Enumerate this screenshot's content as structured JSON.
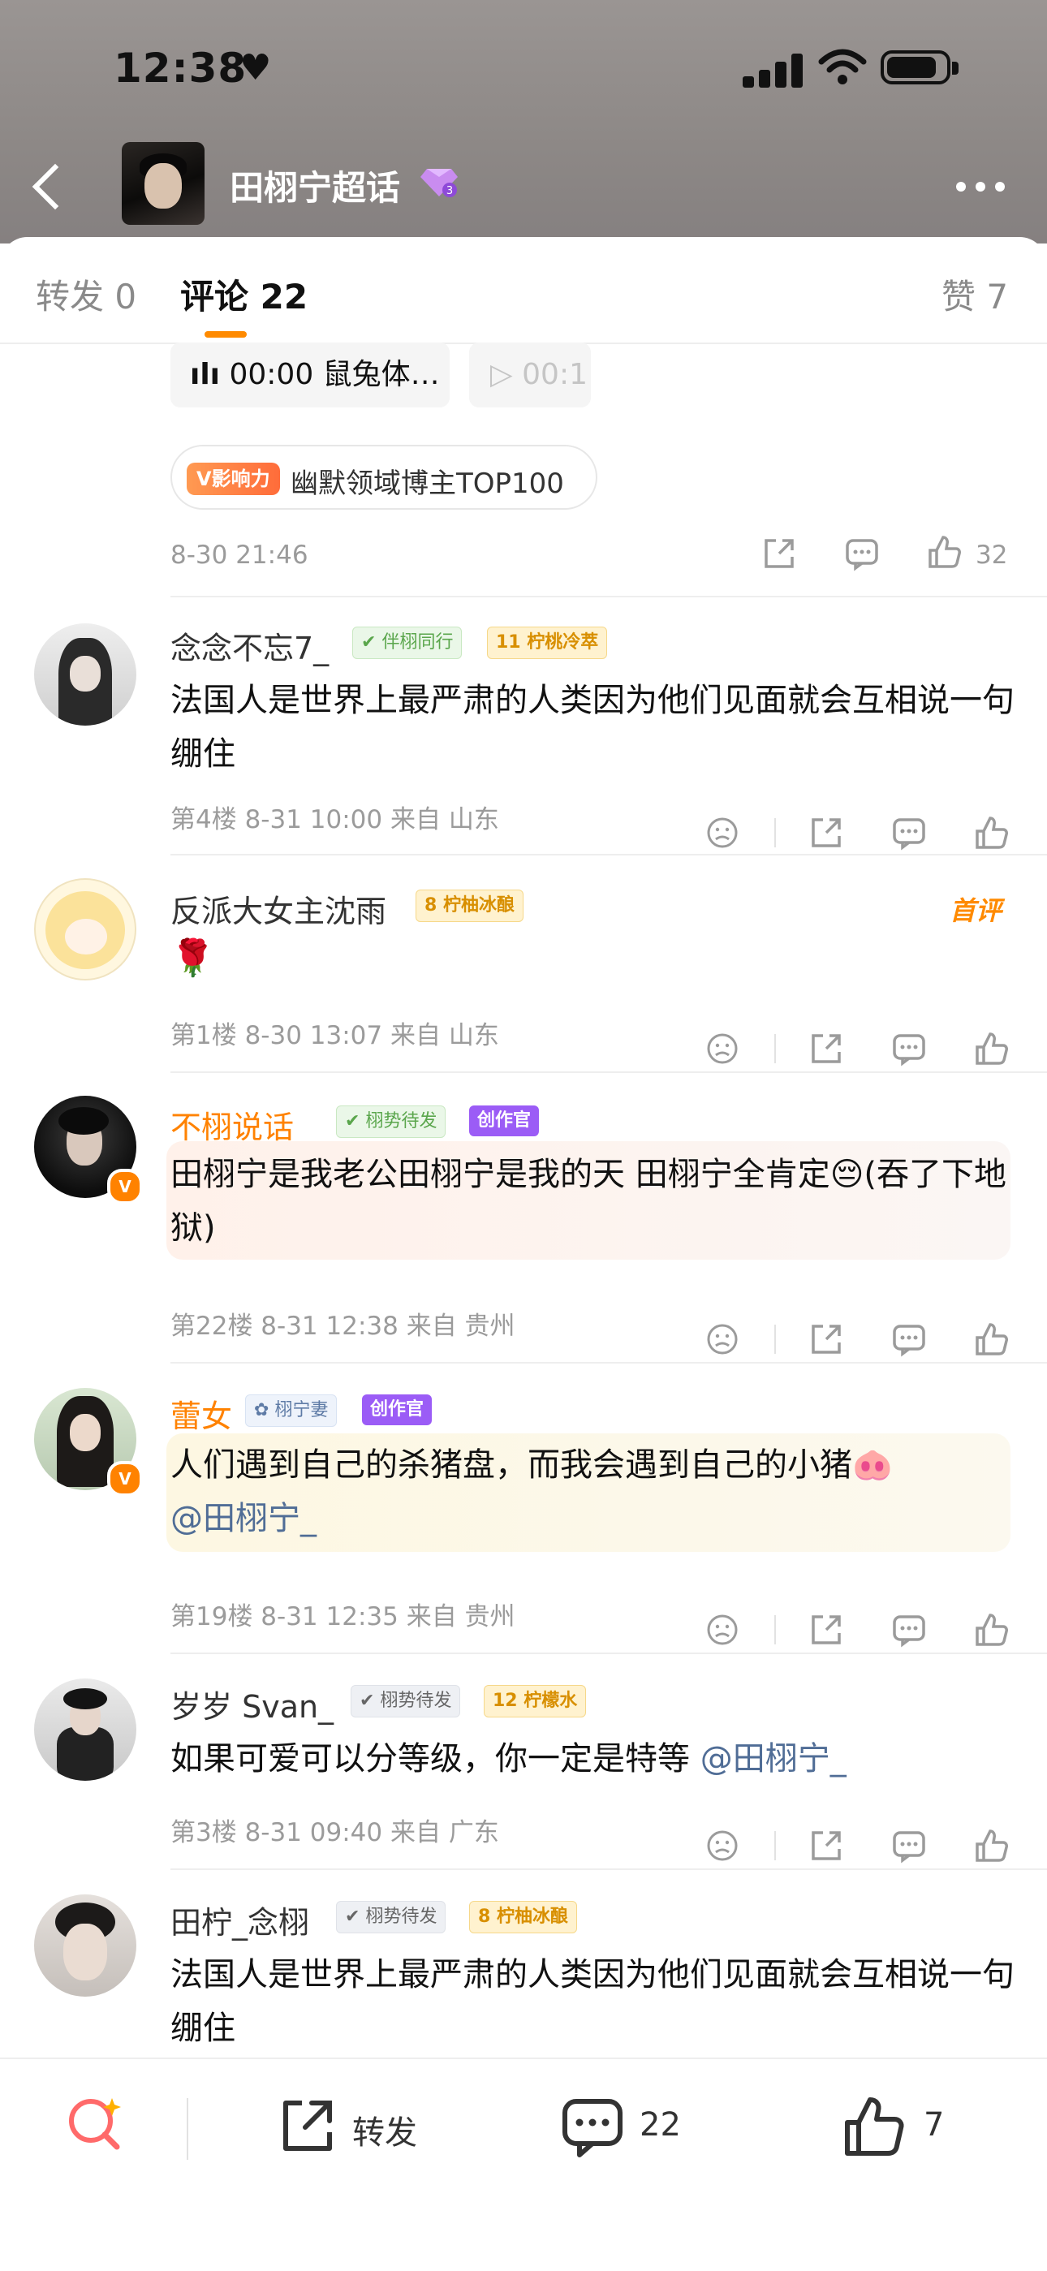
{
  "status_bar": {
    "time": "12:38",
    "heart": "♥"
  },
  "header": {
    "title": "田栩宁超话",
    "level_icon": "gem-level-3-icon"
  },
  "tabs": [
    {
      "label": "转发 0"
    },
    {
      "label": "评论 22"
    },
    {
      "label": "赞 7"
    }
  ],
  "top_card": {
    "audio_chips": [
      {
        "text": "00:00 鼠兔体…"
      },
      {
        "text": "00:1"
      }
    ],
    "influence_badge": "V影响力",
    "influence_text": "幽默领域博主TOP100",
    "timestamp": "8-30 21:46",
    "like_count": "32"
  },
  "comments": [
    {
      "username": "念念不忘7_",
      "tags": [
        "伴栩同行",
        "11",
        "柠桃冷萃"
      ],
      "text": "法国人是世界上最严肃的人类因为他们见面就会互相说一句绷住",
      "meta": "第4楼  8-31 10:00  来自 山东"
    },
    {
      "username": "反派大女主沈雨",
      "tags": [
        "8",
        "柠柚冰酿"
      ],
      "text": "🌹",
      "meta": "第1楼  8-30 13:07  来自 山东",
      "first_comment_label": "首评"
    },
    {
      "username": "不栩说话_",
      "tags": [
        "栩势待发",
        "创作官"
      ],
      "text": "田栩宁是我老公田栩宁是我的天 田栩宁全肯定😔(吞了下地狱)",
      "meta": "第22楼  8-31 12:38  来自 贵州"
    },
    {
      "username": "蕾女",
      "tags": [
        "栩宁妻",
        "创作官"
      ],
      "text": "人们遇到自己的杀猪盘，而我会遇到自己的小猪🐽",
      "mention": "@田栩宁_",
      "meta": "第19楼  8-31 12:35  来自 贵州"
    },
    {
      "username": "岁岁 Svan_",
      "tags": [
        "栩势待发",
        "12",
        "柠檬水"
      ],
      "text": "如果可爱可以分等级，你一定是特等",
      "mention": "@田栩宁_",
      "meta": "第3楼  8-31 09:40  来自 广东"
    },
    {
      "username": "田柠_念栩",
      "tags": [
        "栩势待发",
        "8",
        "柠柚冰酿"
      ],
      "text": "法国人是世界上最严肃的人类因为他们见面就会互相说一句绷住"
    }
  ],
  "bottom_bar": {
    "repost_label": "转发",
    "comment_count": "22",
    "like_count": "7"
  },
  "colors": {
    "accent": "#ff8200",
    "mention": "#506d96",
    "meta": "#9b9b9b"
  }
}
